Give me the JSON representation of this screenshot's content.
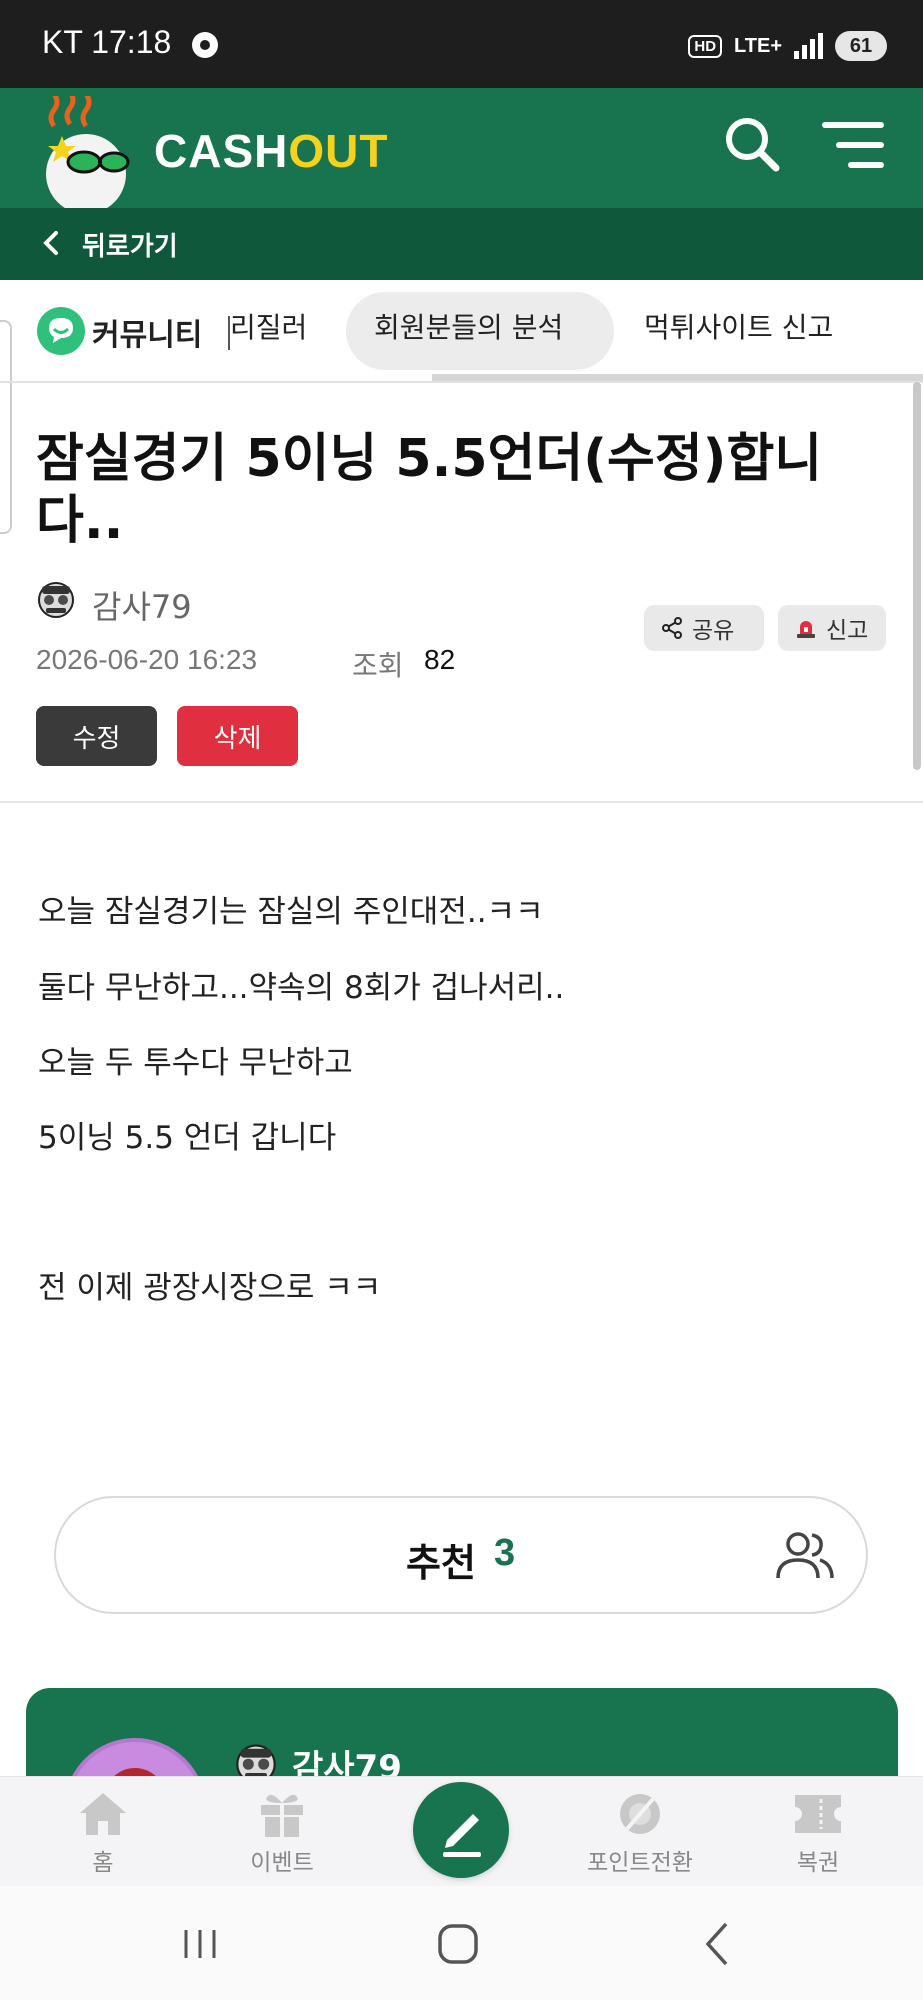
{
  "status_bar": {
    "time": "KT 17:18",
    "hd": "HD",
    "network": "LTE+",
    "battery": "61"
  },
  "header": {
    "brand_cash": "CASH",
    "brand_out": "OUT",
    "brand_color": "#17744f",
    "accent_color": "#f6d21c",
    "back_label": "뒤로가기"
  },
  "tabs": {
    "community_label": "커뮤니티",
    "items": [
      "리질러",
      "회원분들의 분석",
      "먹튀사이트 신고"
    ],
    "active_index": 1
  },
  "post": {
    "title": "잠실경기 5이닝 5.5언더(수정)합니다..",
    "author": "감사79",
    "date": "2026-06-20 16:23",
    "views_label": "조회",
    "views": "82",
    "share_label": "공유",
    "report_label": "신고",
    "edit_label": "수정",
    "delete_label": "삭제",
    "content": [
      "오늘 잠실경기는 잠실의 주인대전..ㅋㅋ",
      "둘다 무난하고...약속의 8회가 겁나서리..",
      "오늘 두 투수다 무난하고",
      "5이닝 5.5 언더 갑니다",
      "",
      "전 이제 광장시장으로 ㅋㅋ"
    ]
  },
  "recommend": {
    "label": "추천",
    "count": "3"
  },
  "author_card": {
    "name": "감사79"
  },
  "bottom_nav": {
    "home": "홈",
    "event": "이벤트",
    "points": "포인트전환",
    "lottery": "복권"
  }
}
